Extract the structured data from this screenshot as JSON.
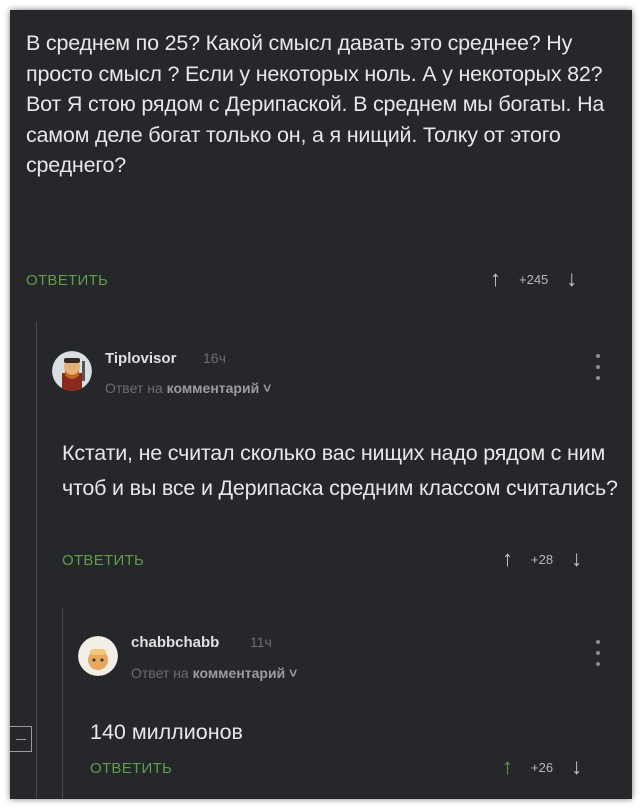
{
  "comments": [
    {
      "text": "В среднем по 25? Какой смысл давать это среднее? Ну просто смысл ? Если у некоторых ноль. А у некоторых 82? Вот Я стою рядом с Дерипаской. В среднем мы богаты. На самом деле богат только он, а я нищий. Толку от этого среднего?",
      "reply_label": "ОТВЕТИТЬ",
      "score": "+245"
    },
    {
      "username": "Tiplovisor",
      "time": "16ч",
      "reply_to_prefix": "Ответ на",
      "reply_to_link": "комментарий ˅",
      "text": "Кстати, не считал сколько вас нищих надо рядом с ним чтоб и вы все и Дерипаска средним классом считались?",
      "reply_label": "ОТВЕТИТЬ",
      "score": "+28"
    },
    {
      "username": "chabbchabb",
      "time": "11ч",
      "reply_to_prefix": "Ответ на",
      "reply_to_link": "комментарий ˅",
      "text": "140 миллионов",
      "reply_label": "ОТВЕТИТЬ",
      "score": "+26",
      "upvoted": true
    }
  ],
  "icons": {
    "upvote": "↑",
    "downvote": "↓"
  },
  "colors": {
    "background": "#25272b",
    "accent": "#5f9e48",
    "text": "#e7e7e7",
    "muted": "#6b6d71"
  }
}
